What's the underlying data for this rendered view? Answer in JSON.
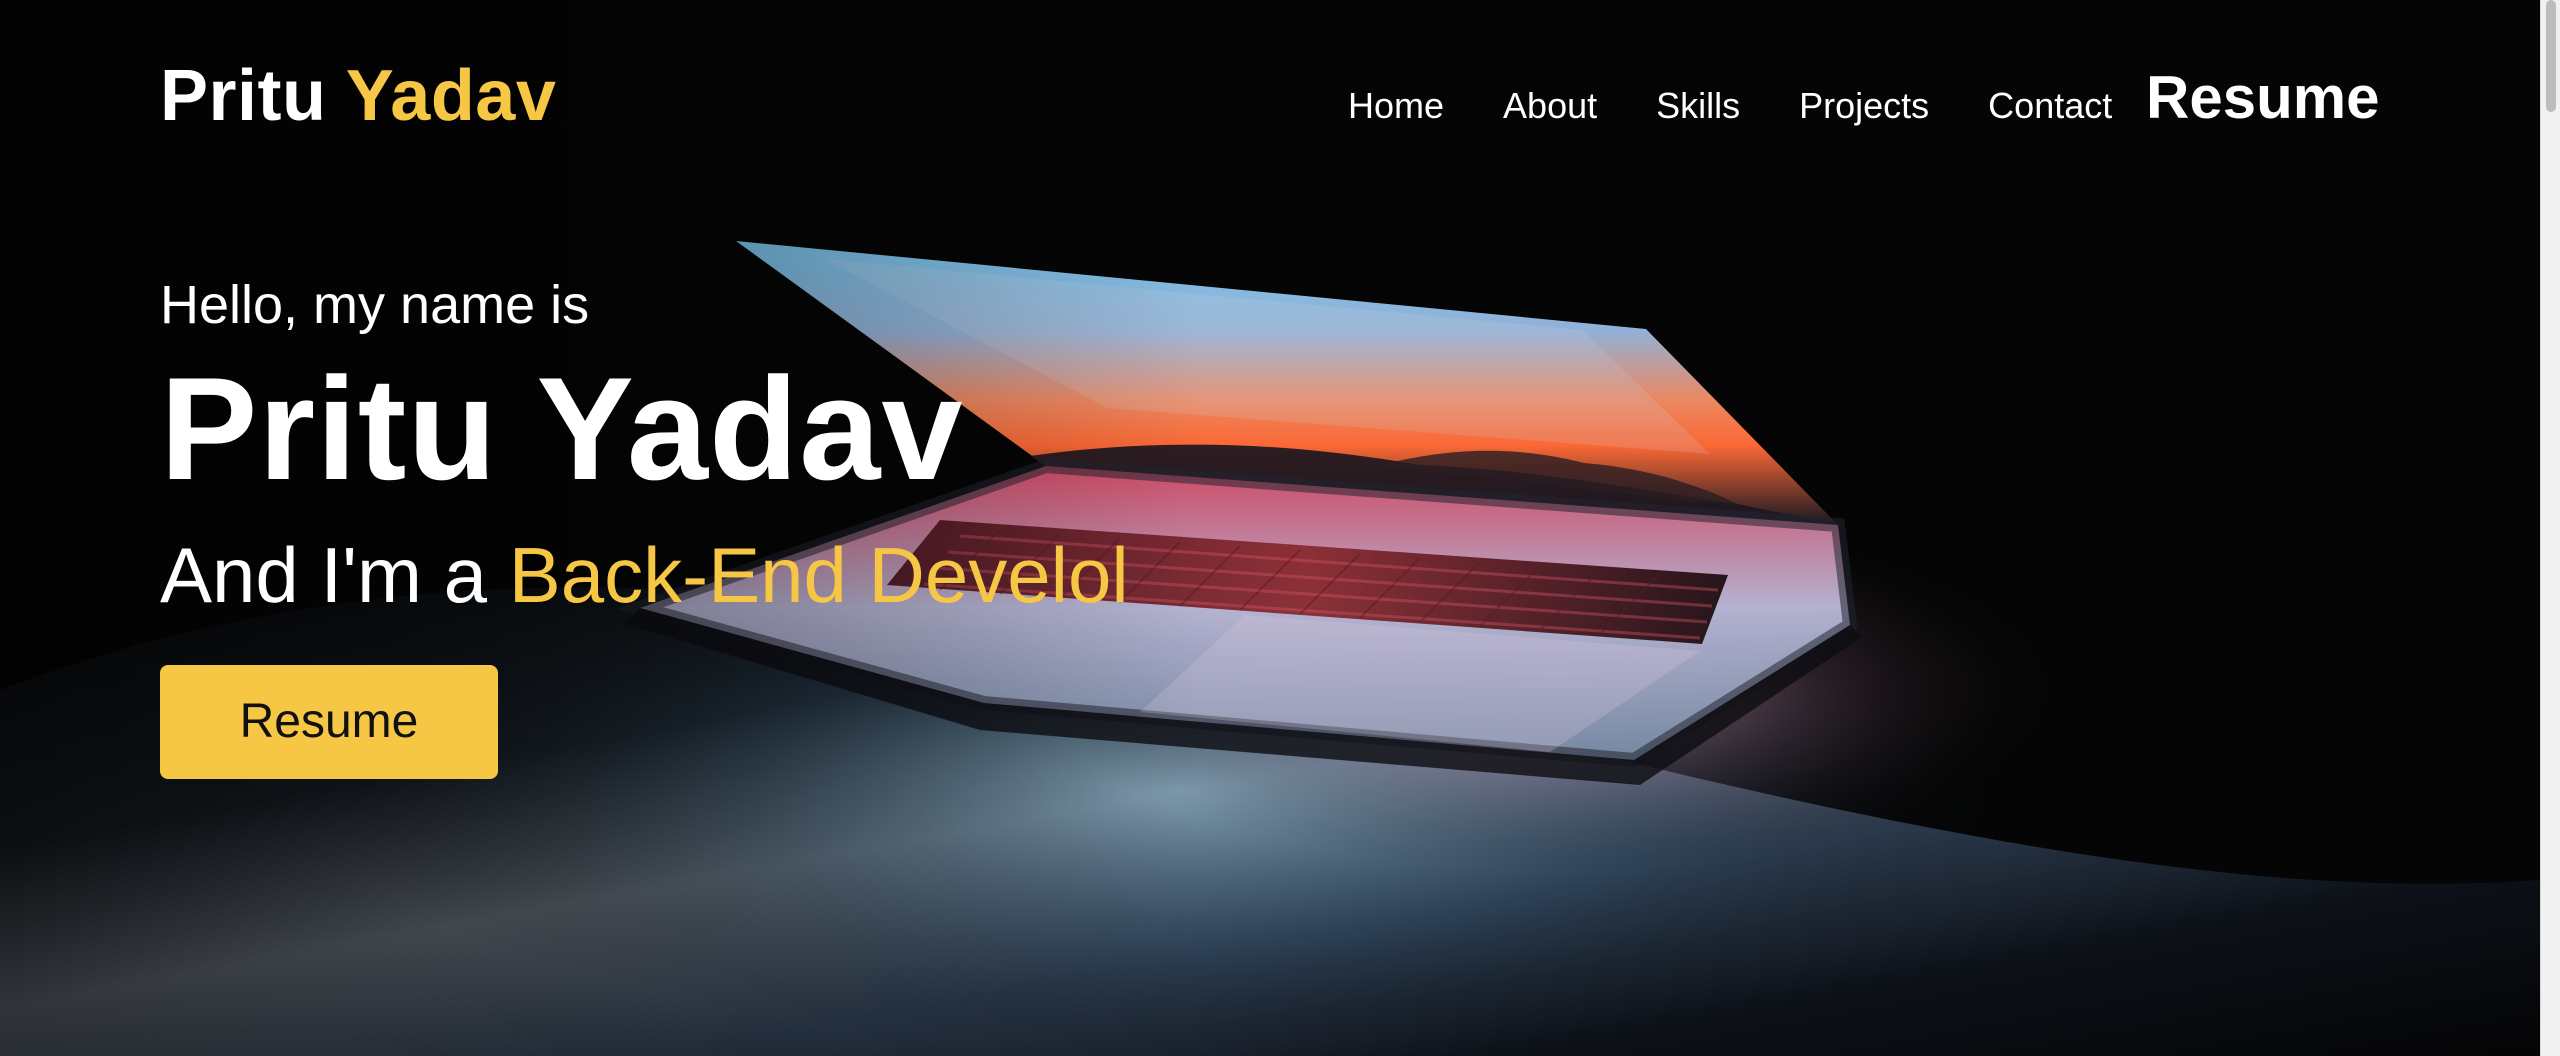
{
  "header": {
    "logo_first": "Pritu",
    "logo_accent": "Yadav",
    "nav_items": [
      "Home",
      "About",
      "Skills",
      "Projects",
      "Contact"
    ],
    "resume_link": "Resume"
  },
  "hero": {
    "intro": "Hello, my name is",
    "name": "Pritu Yadav",
    "role_prefix": "And I'm a",
    "role": "Back-End Develol",
    "cta_label": "Resume"
  },
  "colors": {
    "background": "#050505",
    "accent": "#f6c744",
    "text": "#ffffff",
    "button_text": "#111111"
  },
  "icons": {
    "hero_image": "laptop-photo"
  }
}
